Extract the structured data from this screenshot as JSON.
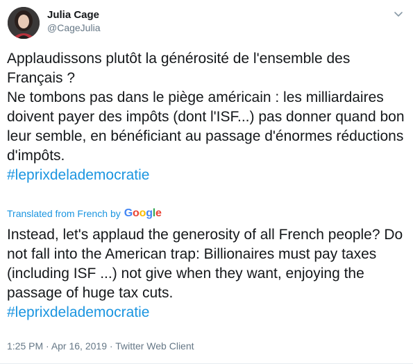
{
  "author": {
    "display_name": "Julia Cage",
    "handle": "@CageJulia",
    "avatar_icon": "profile-photo"
  },
  "tweet": {
    "text": "Applaudissons plutôt la générosité de l'ensemble des Français ?\nNe tombons pas dans le piège américain : les milliardaires doivent payer des impôts (dont l'ISF...) pas donner quand bon leur semble, en bénéficiant au passage d'énormes réductions d'impôts.",
    "hashtag": "#leprixdelademocratie"
  },
  "translation": {
    "label": "Translated from French",
    "by": "by",
    "provider": "Google",
    "text": "Instead, let's applaud the generosity of all French people? Do not fall into the American trap: Billionaires must pay taxes (including ISF ...) not give when they want, enjoying the passage of huge tax cuts.",
    "hashtag": "#leprixdelademocratie"
  },
  "meta": {
    "time": "1:25 PM",
    "separator": " · ",
    "date": "Apr 16, 2019",
    "client": "Twitter Web Client"
  },
  "colors": {
    "link": "#1b95e0",
    "text": "#14171a",
    "secondary": "#657786"
  },
  "icons": {
    "menu": "chevron-down-icon"
  }
}
